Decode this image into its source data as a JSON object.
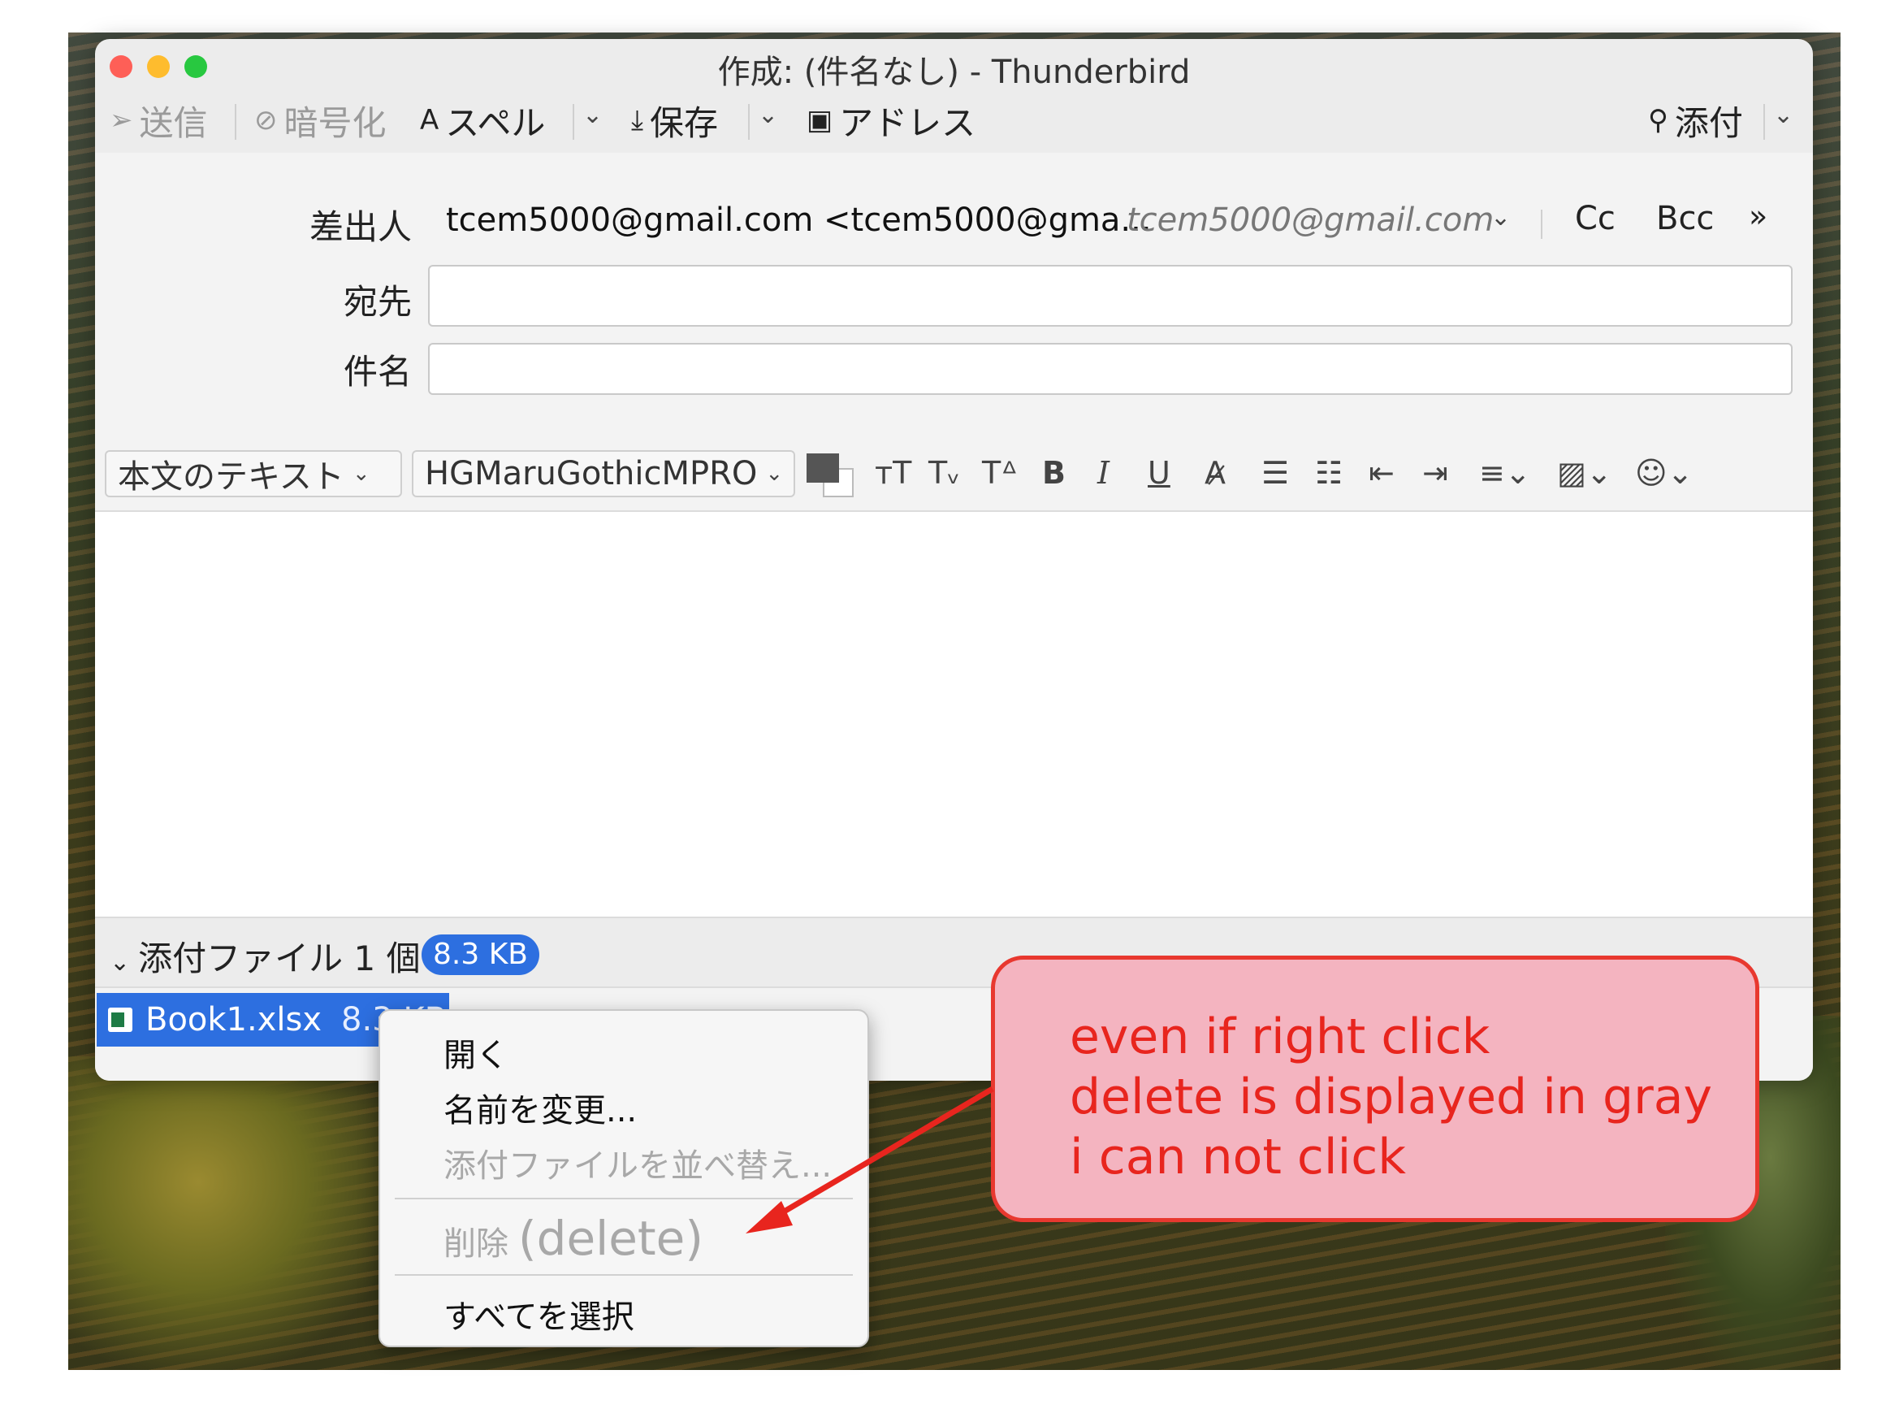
{
  "window": {
    "title": "作成: (件名なし) - Thunderbird"
  },
  "toolbar": {
    "send": "送信",
    "encrypt": "暗号化",
    "spell": "スペル",
    "save": "保存",
    "address": "アドレス",
    "attach": "添付"
  },
  "headers": {
    "from_label": "差出人",
    "from_value": "tcem5000@gmail.com <tcem5000@gma...",
    "from_identity": "tcem5000@gmail.com",
    "cc": "Cc",
    "bcc": "Bcc",
    "to_label": "宛先",
    "to_value": "",
    "subject_label": "件名",
    "subject_value": ""
  },
  "format": {
    "paragraph_style": "本文のテキスト",
    "font": "HGMaruGothicMPRO"
  },
  "attachments": {
    "header": "添付ファイル 1 個",
    "total_size": "8.3 KB",
    "items": [
      {
        "name": "Book1.xlsx",
        "size": "8.3 KB"
      }
    ]
  },
  "context_menu": {
    "open": "開く",
    "rename": "名前を変更...",
    "sort": "添付ファイルを並べ替え...",
    "delete": "削除",
    "delete_note": "(delete)",
    "select_all": "すべてを選択"
  },
  "annotation": {
    "line1": "even if right click",
    "line2": "delete is displayed in gray",
    "line3": "i can not click"
  },
  "colors": {
    "accent": "#2d6fe0",
    "annotation_red": "#e8251e",
    "annotation_fill": "#f4b4c0"
  }
}
